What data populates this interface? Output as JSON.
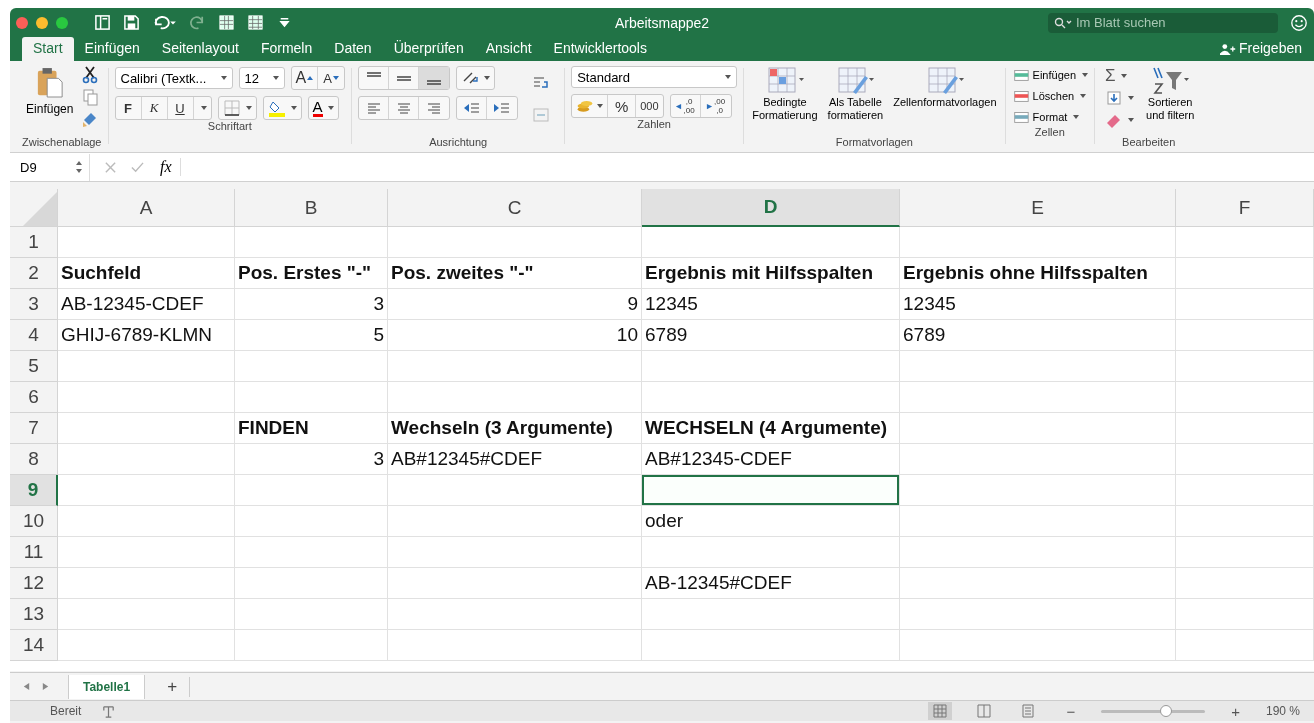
{
  "window": {
    "title": "Arbeitsmappe2"
  },
  "search": {
    "placeholder": "Im Blatt suchen"
  },
  "share_button": "Freigeben",
  "tabs": [
    {
      "label": "Start",
      "selected": true
    },
    {
      "label": "Einfügen",
      "selected": false
    },
    {
      "label": "Seitenlayout",
      "selected": false
    },
    {
      "label": "Formeln",
      "selected": false
    },
    {
      "label": "Daten",
      "selected": false
    },
    {
      "label": "Überprüfen",
      "selected": false
    },
    {
      "label": "Ansicht",
      "selected": false
    },
    {
      "label": "Entwicklertools",
      "selected": false
    }
  ],
  "clipboard": {
    "label": "Zwischenablage",
    "paste": "Einfügen"
  },
  "font": {
    "label": "Schriftart",
    "family": "Calibri (Textk...",
    "size": "12",
    "grow": "A",
    "shrink": "A",
    "bold": "F",
    "italic": "K",
    "underline": "U",
    "color_letter": "A"
  },
  "alignment": {
    "label": "Ausrichtung"
  },
  "number": {
    "label": "Zahlen",
    "format": "Standard",
    "percent": "%",
    "thousands": "000",
    "increase_decimal": [
      ",0",
      ",00"
    ],
    "decrease_decimal": [
      ",00",
      ",0"
    ]
  },
  "styles": {
    "label": "Formatvorlagen",
    "items": [
      "Bedingte\nFormatierung",
      "Als Tabelle\nformatieren",
      "Zellenformatvorlagen"
    ]
  },
  "cells_group": {
    "label": "Zellen",
    "items": [
      "Einfügen",
      "Löschen",
      "Format"
    ]
  },
  "editing": {
    "label": "Bearbeiten",
    "sum": "Σ",
    "sort": "Sortieren\nund filtern"
  },
  "formula_bar": {
    "name_box": "D9",
    "fx": "fx"
  },
  "grid": {
    "columns": [
      {
        "label": "A",
        "selected": false
      },
      {
        "label": "B",
        "selected": false
      },
      {
        "label": "C",
        "selected": false
      },
      {
        "label": "D",
        "selected": true
      },
      {
        "label": "E",
        "selected": false
      },
      {
        "label": "F",
        "selected": false
      }
    ],
    "rows": [
      {
        "label": "1",
        "selected": false,
        "cells": [
          {
            "kind": "empty",
            "selected": false
          },
          {
            "kind": "empty",
            "selected": false
          },
          {
            "kind": "empty",
            "selected": false
          },
          {
            "kind": "empty",
            "selected": false
          },
          {
            "kind": "empty",
            "selected": false
          },
          {
            "kind": "empty",
            "selected": false
          }
        ]
      },
      {
        "label": "2",
        "selected": false,
        "cells": [
          {
            "kind": "label",
            "text": "Suchfeld",
            "selected": false
          },
          {
            "kind": "label",
            "text": "Pos. Erstes \"-\"",
            "selected": false
          },
          {
            "kind": "label",
            "text": "Pos. zweites \"-\"",
            "selected": false
          },
          {
            "kind": "label",
            "text": "Ergebnis mit Hilfsspalten",
            "selected": false
          },
          {
            "kind": "label",
            "text": "Ergebnis ohne Hilfsspalten",
            "selected": false
          },
          {
            "kind": "empty",
            "selected": false
          }
        ]
      },
      {
        "label": "3",
        "selected": false,
        "cells": [
          {
            "kind": "text",
            "text": "AB-12345-CDEF",
            "selected": false
          },
          {
            "kind": "number",
            "text": "3",
            "selected": false
          },
          {
            "kind": "number",
            "text": "9",
            "selected": false
          },
          {
            "kind": "text",
            "text": "12345",
            "selected": false
          },
          {
            "kind": "text",
            "text": "12345",
            "selected": false
          },
          {
            "kind": "empty",
            "selected": false
          }
        ]
      },
      {
        "label": "4",
        "selected": false,
        "cells": [
          {
            "kind": "text",
            "text": "GHIJ-6789-KLMN",
            "selected": false
          },
          {
            "kind": "number",
            "text": "5",
            "selected": false
          },
          {
            "kind": "number",
            "text": "10",
            "selected": false
          },
          {
            "kind": "text",
            "text": "6789",
            "selected": false
          },
          {
            "kind": "text",
            "text": "6789",
            "selected": false
          },
          {
            "kind": "empty",
            "selected": false
          }
        ]
      },
      {
        "label": "5",
        "selected": false,
        "cells": [
          {
            "kind": "empty",
            "selected": false
          },
          {
            "kind": "empty",
            "selected": false
          },
          {
            "kind": "empty",
            "selected": false
          },
          {
            "kind": "empty",
            "selected": false
          },
          {
            "kind": "empty",
            "selected": false
          },
          {
            "kind": "empty",
            "selected": false
          }
        ]
      },
      {
        "label": "6",
        "selected": false,
        "cells": [
          {
            "kind": "empty",
            "selected": false
          },
          {
            "kind": "empty",
            "selected": false
          },
          {
            "kind": "empty",
            "selected": false
          },
          {
            "kind": "empty",
            "selected": false
          },
          {
            "kind": "empty",
            "selected": false
          },
          {
            "kind": "empty",
            "selected": false
          }
        ]
      },
      {
        "label": "7",
        "selected": false,
        "cells": [
          {
            "kind": "empty",
            "selected": false
          },
          {
            "kind": "label",
            "text": "FINDEN",
            "selected": false
          },
          {
            "kind": "label",
            "text": "Wechseln (3 Argumente)",
            "selected": false
          },
          {
            "kind": "label",
            "text": "WECHSELN (4 Argumente)",
            "selected": false
          },
          {
            "kind": "empty",
            "selected": false
          },
          {
            "kind": "empty",
            "selected": false
          }
        ]
      },
      {
        "label": "8",
        "selected": false,
        "cells": [
          {
            "kind": "empty",
            "selected": false
          },
          {
            "kind": "number",
            "text": "3",
            "selected": false
          },
          {
            "kind": "text",
            "text": "AB#12345#CDEF",
            "selected": false
          },
          {
            "kind": "text",
            "text": "AB#12345-CDEF",
            "selected": false
          },
          {
            "kind": "empty",
            "selected": false
          },
          {
            "kind": "empty",
            "selected": false
          }
        ]
      },
      {
        "label": "9",
        "selected": true,
        "cells": [
          {
            "kind": "empty",
            "selected": false
          },
          {
            "kind": "empty",
            "selected": false
          },
          {
            "kind": "empty",
            "selected": false
          },
          {
            "kind": "empty",
            "selected": true
          },
          {
            "kind": "empty",
            "selected": false
          },
          {
            "kind": "empty",
            "selected": false
          }
        ]
      },
      {
        "label": "10",
        "selected": false,
        "cells": [
          {
            "kind": "empty",
            "selected": false
          },
          {
            "kind": "empty",
            "selected": false
          },
          {
            "kind": "empty",
            "selected": false
          },
          {
            "kind": "text",
            "text": "oder",
            "selected": false
          },
          {
            "kind": "empty",
            "selected": false
          },
          {
            "kind": "empty",
            "selected": false
          }
        ]
      },
      {
        "label": "11",
        "selected": false,
        "cells": [
          {
            "kind": "empty",
            "selected": false
          },
          {
            "kind": "empty",
            "selected": false
          },
          {
            "kind": "empty",
            "selected": false
          },
          {
            "kind": "empty",
            "selected": false
          },
          {
            "kind": "empty",
            "selected": false
          },
          {
            "kind": "empty",
            "selected": false
          }
        ]
      },
      {
        "label": "12",
        "selected": false,
        "cells": [
          {
            "kind": "empty",
            "selected": false
          },
          {
            "kind": "empty",
            "selected": false
          },
          {
            "kind": "empty",
            "selected": false
          },
          {
            "kind": "text",
            "text": "AB-12345#CDEF",
            "selected": false
          },
          {
            "kind": "empty",
            "selected": false
          },
          {
            "kind": "empty",
            "selected": false
          }
        ]
      },
      {
        "label": "13",
        "selected": false,
        "cells": [
          {
            "kind": "empty",
            "selected": false
          },
          {
            "kind": "empty",
            "selected": false
          },
          {
            "kind": "empty",
            "selected": false
          },
          {
            "kind": "empty",
            "selected": false
          },
          {
            "kind": "empty",
            "selected": false
          },
          {
            "kind": "empty",
            "selected": false
          }
        ]
      },
      {
        "label": "14",
        "selected": false,
        "cells": [
          {
            "kind": "empty",
            "selected": false
          },
          {
            "kind": "empty",
            "selected": false
          },
          {
            "kind": "empty",
            "selected": false
          },
          {
            "kind": "empty",
            "selected": false
          },
          {
            "kind": "empty",
            "selected": false
          },
          {
            "kind": "empty",
            "selected": false
          }
        ]
      }
    ]
  },
  "sheet_tabs": [
    {
      "label": "Tabelle1",
      "selected": true
    }
  ],
  "add_sheet": "+",
  "status_bar": {
    "text": "Bereit",
    "zoom_out": "−",
    "zoom_in": "+",
    "zoom": {
      "level": 0.62
    },
    "zoom_reading": "190 %"
  }
}
